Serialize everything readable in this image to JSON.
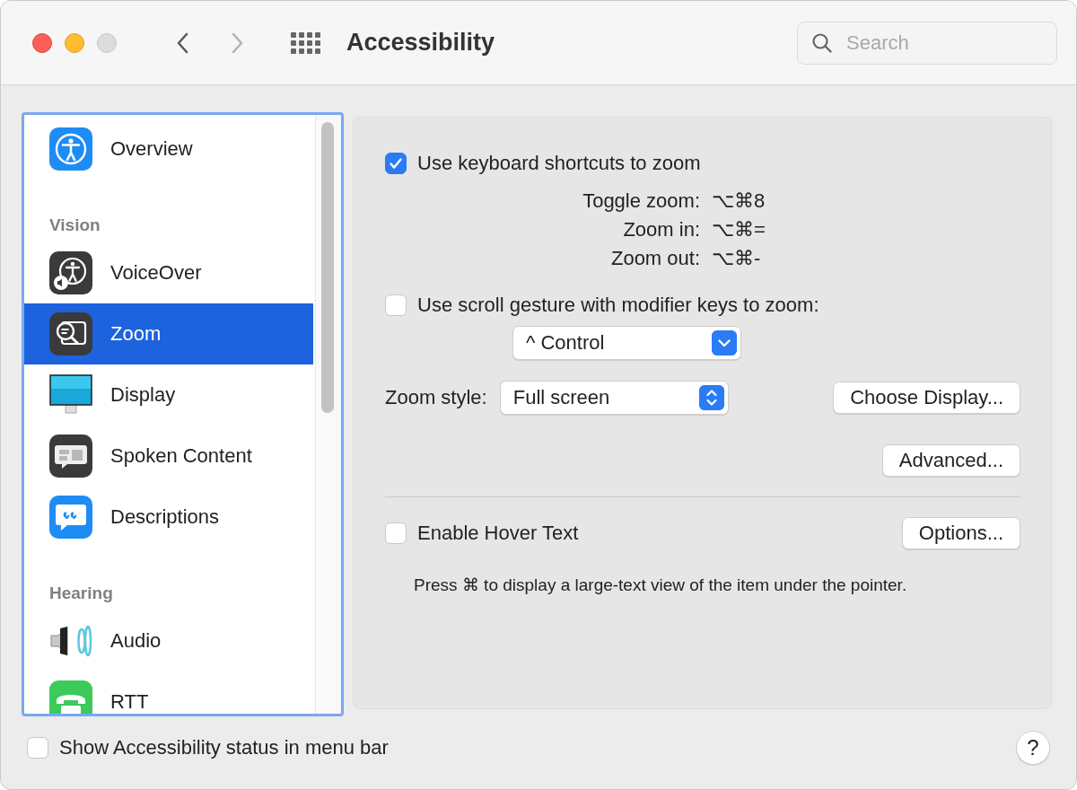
{
  "window": {
    "title": "Accessibility",
    "traffic_lights": [
      {
        "kind": "close",
        "disabled": false
      },
      {
        "kind": "minimize",
        "disabled": false
      },
      {
        "kind": "zoom",
        "disabled": true
      }
    ],
    "nav": [
      {
        "kind": "back",
        "disabled": false
      },
      {
        "kind": "forward",
        "disabled": true
      }
    ],
    "search": {
      "placeholder": "Search"
    }
  },
  "sidebar": {
    "sections": [
      {
        "items": [
          {
            "kind": "overview",
            "label": "Overview",
            "selected": false
          }
        ]
      },
      {
        "heading": "Vision",
        "items": [
          {
            "kind": "voiceover",
            "label": "VoiceOver",
            "selected": false
          },
          {
            "kind": "zoom",
            "label": "Zoom",
            "selected": true
          },
          {
            "kind": "display",
            "label": "Display",
            "selected": false
          },
          {
            "kind": "spoken",
            "label": "Spoken Content",
            "selected": false
          },
          {
            "kind": "descriptions",
            "label": "Descriptions",
            "selected": false
          }
        ]
      },
      {
        "heading": "Hearing",
        "items": [
          {
            "kind": "audio",
            "label": "Audio",
            "selected": false
          },
          {
            "kind": "rtt",
            "label": "RTT",
            "selected": false
          }
        ]
      }
    ]
  },
  "pane": {
    "keyboard_shortcuts": {
      "label": "Use keyboard shortcuts to zoom",
      "checked": true
    },
    "shortcuts": [
      {
        "label": "Toggle zoom:",
        "keys": "⌥⌘8"
      },
      {
        "label": "Zoom in:",
        "keys": "⌥⌘="
      },
      {
        "label": "Zoom out:",
        "keys": "⌥⌘-"
      }
    ],
    "scroll_gesture": {
      "label": "Use scroll gesture with modifier keys to zoom:",
      "checked": false
    },
    "modifier_popup": {
      "kind": "pulldown",
      "value": "^ Control"
    },
    "zoom_style": {
      "label": "Zoom style:",
      "kind": "popup",
      "value": "Full screen"
    },
    "choose_display_button": "Choose Display...",
    "advanced_button": "Advanced...",
    "hover_text": {
      "label": "Enable Hover Text",
      "checked": false
    },
    "options_button": "Options...",
    "hover_hint": "Press ⌘ to display a large-text view of the item under the pointer."
  },
  "footer": {
    "status_checkbox": {
      "label": "Show Accessibility status in menu bar",
      "checked": false
    },
    "help_button": "?"
  }
}
